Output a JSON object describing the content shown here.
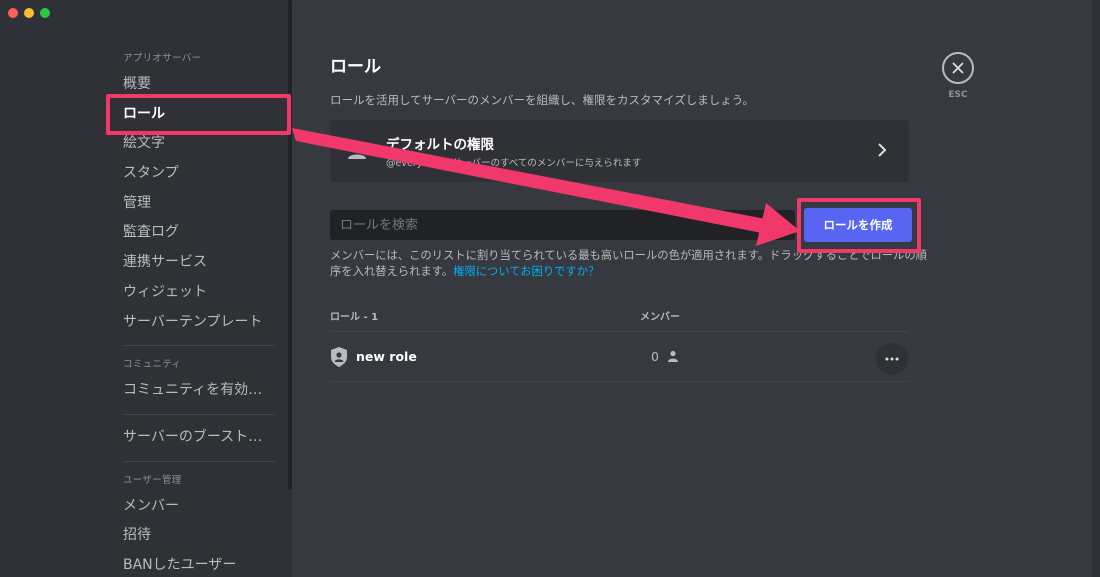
{
  "window": {
    "traffic_lights": [
      {
        "name": "close",
        "color": "#ff5f57"
      },
      {
        "name": "minimize",
        "color": "#febc2e"
      },
      {
        "name": "zoom",
        "color": "#28c840"
      }
    ]
  },
  "sidebar": {
    "sections": [
      {
        "heading": "アプリオサーバー",
        "items": [
          {
            "label": "概要",
            "active": false
          },
          {
            "label": "ロール",
            "active": true
          },
          {
            "label": "絵文字",
            "active": false
          },
          {
            "label": "スタンプ",
            "active": false
          },
          {
            "label": "管理",
            "active": false
          },
          {
            "label": "監査ログ",
            "active": false
          },
          {
            "label": "連携サービス",
            "active": false
          },
          {
            "label": "ウィジェット",
            "active": false
          },
          {
            "label": "サーバーテンプレート",
            "active": false
          }
        ]
      },
      {
        "heading": "コミュニティ",
        "items": [
          {
            "label": "コミュニティを有効に...",
            "active": false
          }
        ]
      },
      {
        "heading": "",
        "items": [
          {
            "label": "サーバーのブースト状態",
            "active": false
          }
        ]
      },
      {
        "heading": "ユーザー管理",
        "items": [
          {
            "label": "メンバー",
            "active": false
          },
          {
            "label": "招待",
            "active": false
          },
          {
            "label": "BANしたユーザー",
            "active": false
          }
        ]
      }
    ]
  },
  "main": {
    "title": "ロール",
    "description": "ロールを活用してサーバーのメンバーを組織し、権限をカスタマイズしましょう。",
    "default_permissions": {
      "title": "デフォルトの権限",
      "subtitle_prefix": "@everyone",
      "subtitle": "はサーバーのすべてのメンバーに与えられます"
    },
    "search": {
      "placeholder": "ロールを検索"
    },
    "create_button": "ロールを作成",
    "help": {
      "text": "メンバーには、このリストに割り当てられている最も高いロールの色が適用されます。ドラッグすることでロールの順序を入れ替えられます。",
      "link": "権限についてお困りですか？"
    },
    "table": {
      "role_header": "ロール - 1",
      "member_header": "メンバー",
      "rows": [
        {
          "name": "new role",
          "members": "0"
        }
      ]
    }
  },
  "close": {
    "esc_label": "ESC"
  },
  "colors": {
    "background": "#36393f",
    "sidebar": "#2f3136",
    "blurple": "#5865f2",
    "highlight": "#f0386b",
    "link": "#00aff4"
  }
}
